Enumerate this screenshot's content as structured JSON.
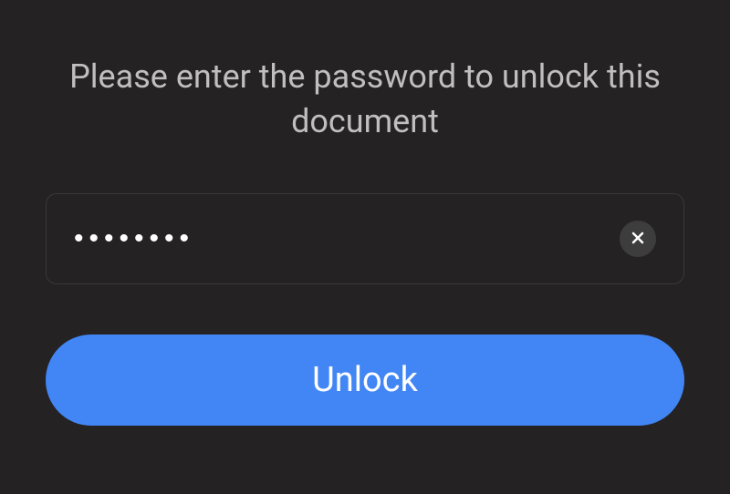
{
  "prompt": {
    "text": "Please enter the password to unlock this document"
  },
  "password": {
    "masked_value": "••••••••",
    "char_count": 8
  },
  "actions": {
    "unlock_label": "Unlock"
  },
  "colors": {
    "background": "#242223",
    "text_muted": "#bfbfbf",
    "accent": "#4286f5",
    "input_border": "#3a3838",
    "clear_button_bg": "#3e3d3e"
  }
}
